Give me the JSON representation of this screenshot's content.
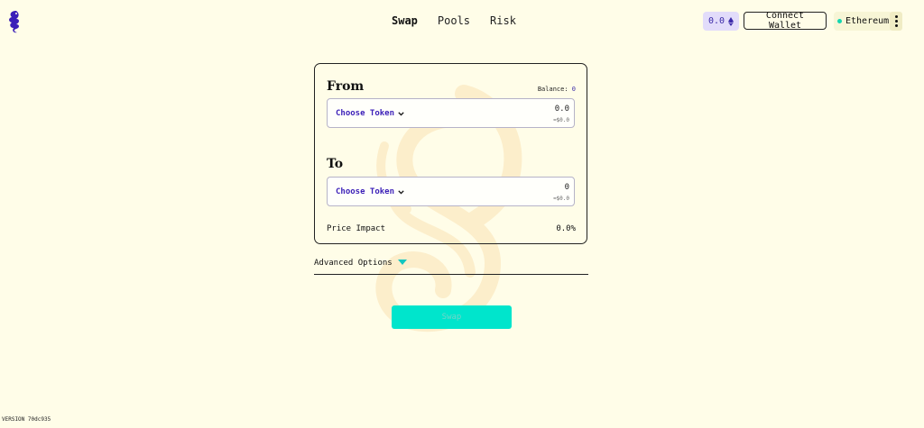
{
  "nav": {
    "tabs": [
      {
        "label": "Swap",
        "active": true
      },
      {
        "label": "Pools",
        "active": false
      },
      {
        "label": "Risk",
        "active": false
      }
    ]
  },
  "header": {
    "balance": "0.0",
    "balance_icon": "eth-icon",
    "connect_label": "Connect Wallet",
    "network": "Ethereum",
    "network_status_color": "#13d6b0"
  },
  "swap": {
    "from": {
      "title": "From",
      "balance_label": "Balance:",
      "balance_value": "0",
      "token_label": "Choose Token",
      "amount": "0.0",
      "usd": "≈$0.0"
    },
    "to": {
      "title": "To",
      "token_label": "Choose Token",
      "amount": "0",
      "usd": "≈$0.0"
    },
    "price_impact_label": "Price Impact",
    "price_impact_value": "0.0%",
    "advanced_label": "Advanced Options",
    "swap_label": "Swap"
  },
  "colors": {
    "background": "#fffde8",
    "accent": "#00e5cc",
    "brand": "#3b1fb8"
  },
  "version": "VERSION 70dc935"
}
